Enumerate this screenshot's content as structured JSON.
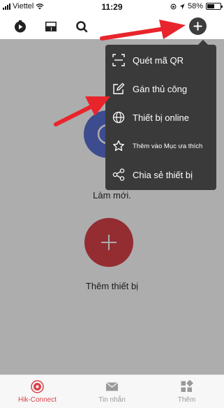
{
  "status_bar": {
    "carrier": "Viettel",
    "time": "11:29",
    "battery_text": "58%",
    "battery_level": 0.58
  },
  "toolbar": {
    "icons": [
      "record-icon",
      "layout-icon",
      "search-icon",
      "add-icon"
    ]
  },
  "main": {
    "refresh_label": "Làm mới.",
    "add_device_label": "Thêm thiết bị"
  },
  "menu": {
    "items": [
      {
        "label": "Quét mã QR",
        "icon": "qr-scan-icon"
      },
      {
        "label": "Gán thủ công",
        "icon": "edit-icon"
      },
      {
        "label": "Thiết bị online",
        "icon": "globe-icon"
      },
      {
        "label": "Thêm vào Mục ưa thích",
        "icon": "star-icon"
      },
      {
        "label": "Chia sẻ thiết bị",
        "icon": "share-icon"
      }
    ]
  },
  "tabs": [
    {
      "label": "Hik-Connect",
      "icon": "hik-connect-icon",
      "active": true
    },
    {
      "label": "Tin nhắn",
      "icon": "message-icon",
      "active": false
    },
    {
      "label": "Thêm",
      "icon": "more-icon",
      "active": false
    }
  ],
  "colors": {
    "accent": "#d9434b",
    "refresh_button": "#5a6fd3",
    "menu_background": "#3a3a3a",
    "annotation_arrow": "#e8252c"
  }
}
